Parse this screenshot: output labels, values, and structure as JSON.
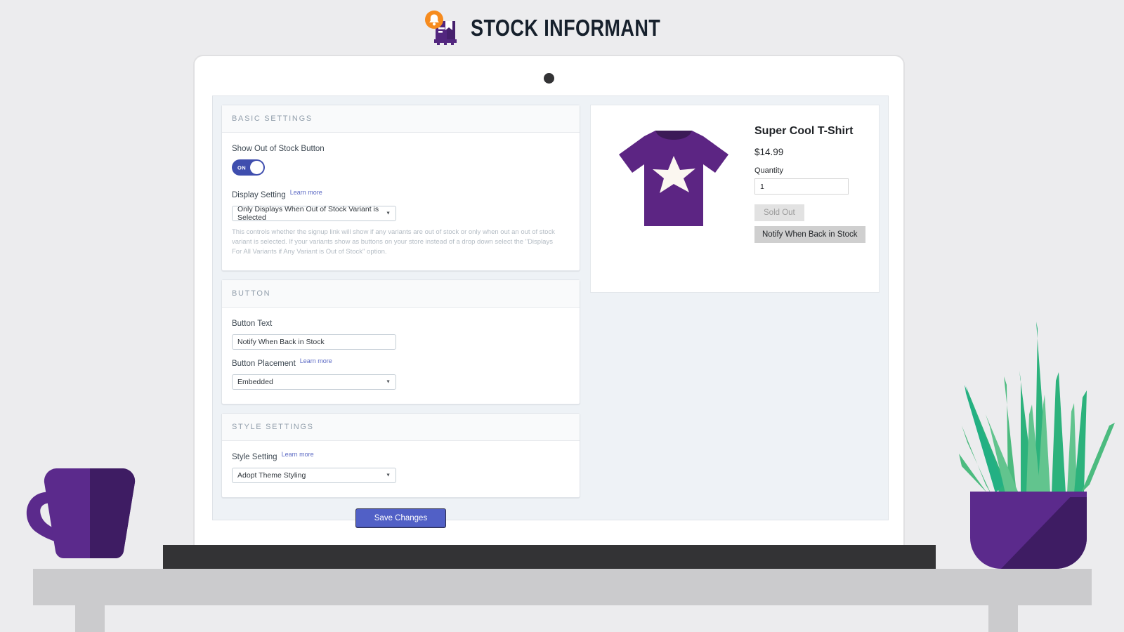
{
  "brand": {
    "title": "STOCK INFORMANT",
    "logo_icons": [
      "bell-icon",
      "package-box-icon"
    ],
    "accent_orange": "#f68b1e",
    "accent_purple": "#52267e"
  },
  "app": {
    "sections": [
      {
        "id": "basic-settings",
        "header": "BASIC SETTINGS",
        "toggle": {
          "label": "Show Out of Stock Button",
          "state_text": "ON",
          "on": true
        },
        "display_setting": {
          "label": "Display Setting",
          "learn_more": "Learn more",
          "value": "Only Displays When Out of Stock Variant is Selected",
          "help": "This controls whether the signup link will show if any variants are out of stock or only when out an out of stock variant is selected. If your variants show as buttons on your store instead of a drop down select the \"Displays For All Variants if Any Variant is Out of Stock\" option."
        }
      },
      {
        "id": "button",
        "header": "BUTTON",
        "button_text": {
          "label": "Button Text",
          "value": "Notify When Back in Stock",
          "placeholder": "Notify When Back in Stock"
        },
        "button_placement": {
          "label": "Button Placement",
          "learn_more": "Learn more",
          "value": "Embedded"
        }
      },
      {
        "id": "style-settings",
        "header": "STYLE SETTINGS",
        "style_setting": {
          "label": "Style Setting",
          "learn_more": "Learn more",
          "value": "Adopt Theme Styling"
        }
      }
    ],
    "save_label": "Save Changes"
  },
  "preview": {
    "product_title": "Super Cool T-Shirt",
    "price": "$14.99",
    "quantity_label": "Quantity",
    "quantity_value": "1",
    "sold_out_label": "Sold Out",
    "notify_label": "Notify When Back in Stock",
    "product_image": "purple-tshirt-with-star"
  },
  "decor": {
    "mug": "purple-coffee-mug",
    "plant": "green-plant-in-purple-pot",
    "laptop": "laptop-device-frame",
    "shelf": "gray-shelf"
  }
}
